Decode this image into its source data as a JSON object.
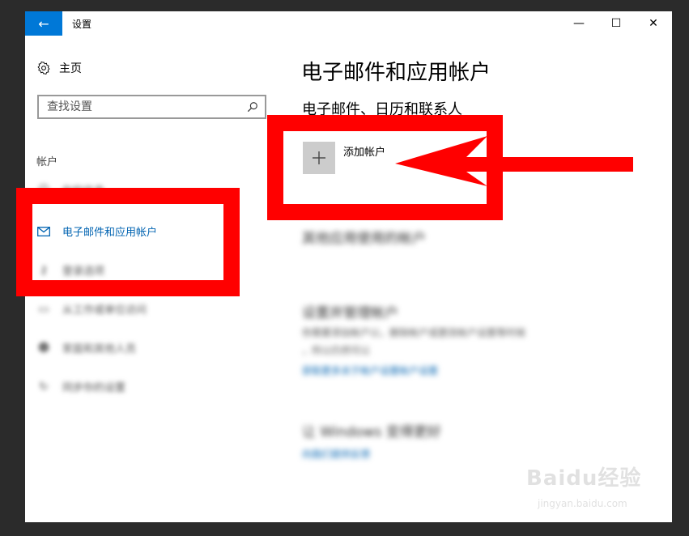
{
  "window": {
    "title": "设置"
  },
  "controls": {
    "minimize": "—",
    "maximize": "☐",
    "close": "✕",
    "back": "←"
  },
  "sidebar": {
    "home_label": "主页",
    "search_placeholder": "查找设置",
    "section_label": "帐户",
    "items": [
      {
        "label": "你的信息",
        "icon": "user-icon",
        "blurred": true
      },
      {
        "label": "电子邮件和应用帐户",
        "icon": "mail-icon",
        "active": true
      },
      {
        "label": "登录选项",
        "icon": "key-icon",
        "blurred": true
      },
      {
        "label": "从工作或单位访问",
        "icon": "briefcase-icon",
        "blurred": true
      },
      {
        "label": "家庭和其他人员",
        "icon": "people-icon",
        "blurred": true
      },
      {
        "label": "同步你的设置",
        "icon": "sync-icon",
        "blurred": true
      }
    ]
  },
  "main": {
    "title": "电子邮件和应用帐户",
    "subtitle": "电子邮件、日历和联系人",
    "add_account_label": "添加帐户",
    "blur_section_1": "其他应用使用的帐户",
    "blur_section_2_head": "设置并管理帐户",
    "blur_section_2_text_1": "你需要添加帐户以，删除帐户或更改帐户设置等时候",
    "blur_section_2_text_2": "，所以仍然可以",
    "blur_section_2_link": "获取更多关于帐户设置帐户设置",
    "blur_section_3_head": "让 Windows 变得更好",
    "blur_section_3_link": "向我们提供反馈"
  },
  "annotation": {
    "color": "#ff0000"
  },
  "watermark": {
    "brand": "Baidu经验",
    "url": "jingyan.baidu.com"
  }
}
